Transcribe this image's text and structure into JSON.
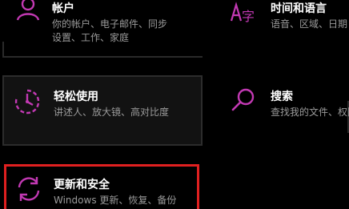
{
  "accent_color": "#c239b3",
  "highlight_color": "#e02020",
  "tiles": {
    "account": {
      "icon": "person-icon",
      "title": "帐户",
      "desc_lines": [
        "你的帐户、电子邮件、同步",
        "设置、工作、家庭"
      ]
    },
    "time": {
      "icon": "time-language-icon",
      "title": "时间和语言",
      "desc_lines": [
        "语音、区域、日期"
      ]
    },
    "ease": {
      "icon": "ease-of-access-icon",
      "title": "轻松使用",
      "desc_lines": [
        "讲述人、放大镜、高对比度"
      ]
    },
    "search": {
      "icon": "search-icon",
      "title": "搜索",
      "desc_lines": [
        "查找我的文件、权限"
      ]
    },
    "update": {
      "icon": "update-security-icon",
      "title": "更新和安全",
      "desc_lines": [
        "Windows 更新、恢复、备份"
      ]
    }
  }
}
